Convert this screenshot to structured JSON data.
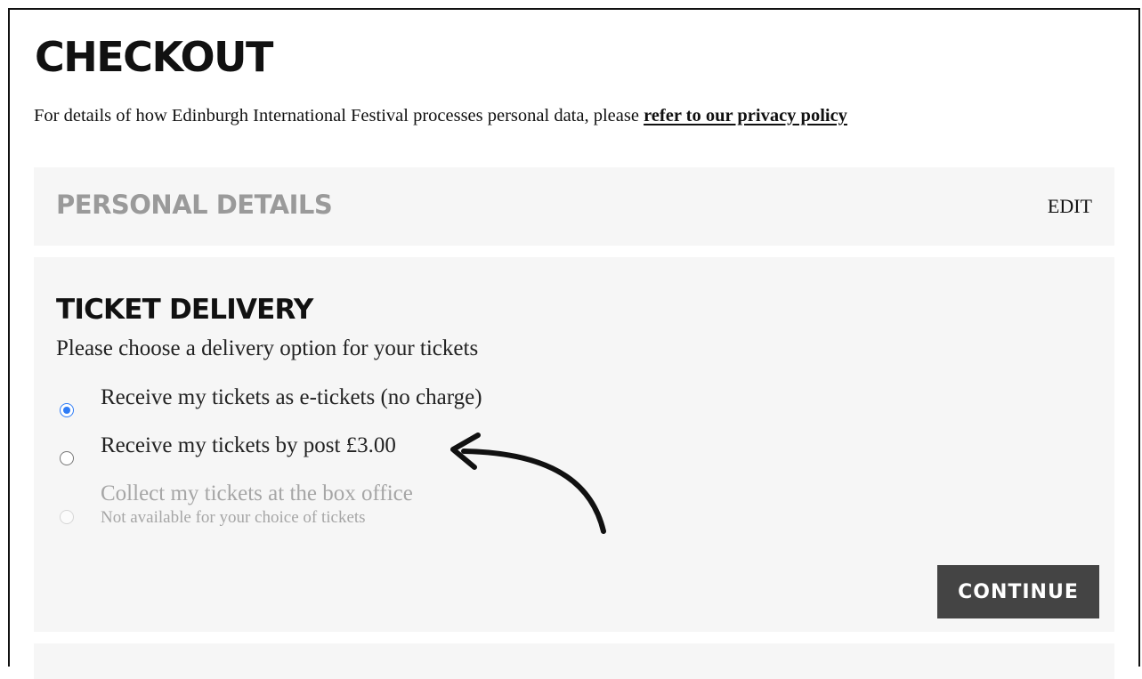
{
  "page": {
    "title": "CHECKOUT",
    "privacy_text": "For details of how Edinburgh International Festival processes personal data, please ",
    "privacy_link": "refer to our privacy policy"
  },
  "personal_details": {
    "title": "PERSONAL DETAILS",
    "edit_label": "EDIT"
  },
  "ticket_delivery": {
    "title": "TICKET DELIVERY",
    "prompt": "Please choose a delivery option for your tickets",
    "options": [
      {
        "label": "Receive my tickets as e-tickets (no charge)",
        "selected": true,
        "disabled": false
      },
      {
        "label": "Receive my tickets by post £3.00",
        "selected": false,
        "disabled": false
      },
      {
        "label": "Collect my tickets at the box office",
        "sublabel": "Not available for your choice of tickets",
        "selected": false,
        "disabled": true
      }
    ],
    "continue_label": "CONTINUE"
  },
  "colors": {
    "radio_accent": "#2f7cf6",
    "button_bg": "#444444",
    "panel_bg": "#f6f6f6",
    "muted_text": "#9a9a9a"
  },
  "annotation": {
    "icon": "curved-arrow-icon",
    "points_to": "Receive my tickets by post £3.00"
  }
}
